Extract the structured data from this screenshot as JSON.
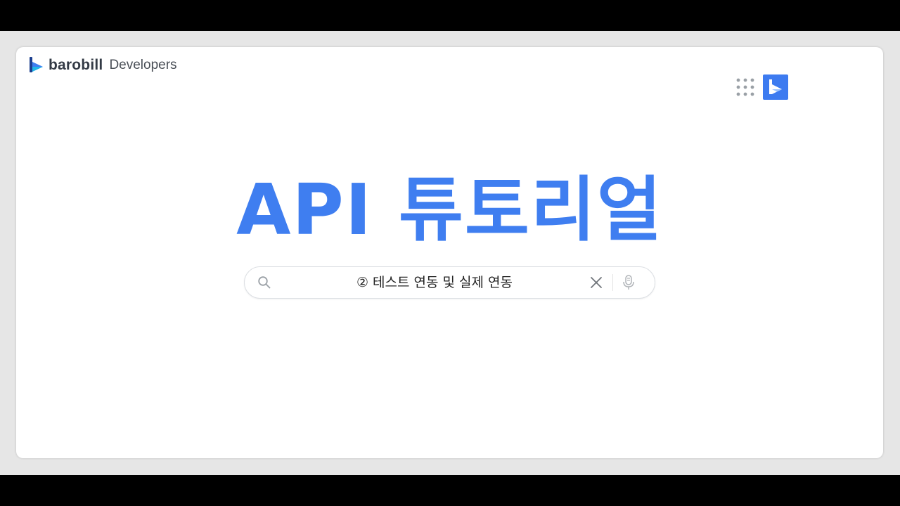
{
  "brand": {
    "name": "barobill",
    "subtitle": "Developers",
    "logo_icon": "barobill-logo-icon"
  },
  "header": {
    "apps_icon": "grid-apps-icon",
    "avatar_icon": "barobill-logo-icon"
  },
  "hero": {
    "title": "API 튜토리얼"
  },
  "search": {
    "value": "② 테스트 연동 및 실제 연동",
    "search_icon": "search-icon",
    "clear_icon": "close-icon",
    "mic_icon": "microphone-icon"
  },
  "colors": {
    "accent": "#3f7ef0",
    "brand_text": "#333a45",
    "logo_dark": "#1c3f8f",
    "logo_cyan": "#22b7e8"
  }
}
